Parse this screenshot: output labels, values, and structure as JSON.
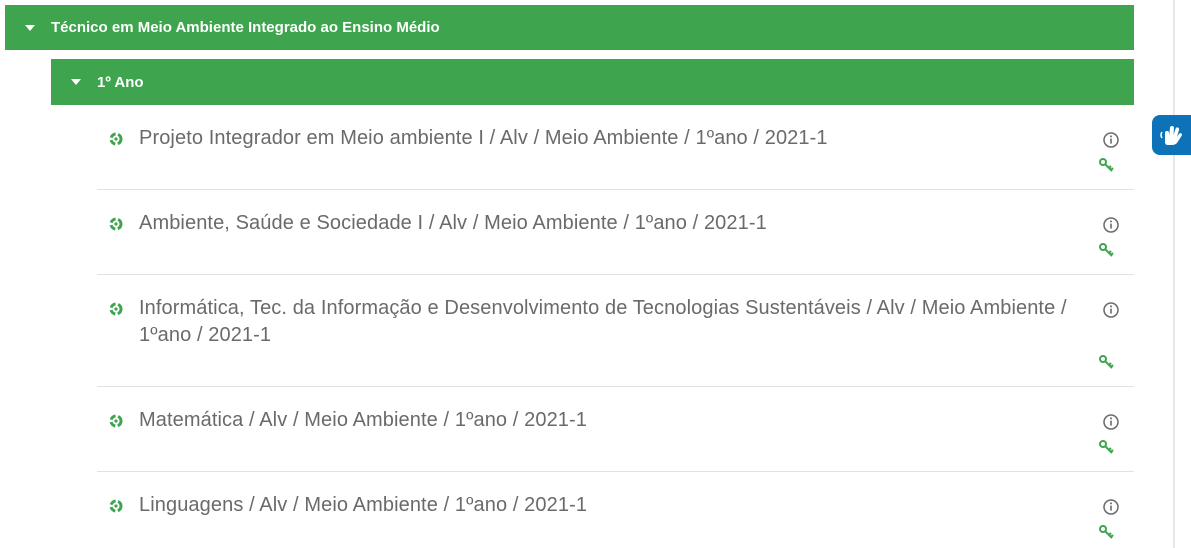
{
  "category": {
    "title": "Técnico em Meio Ambiente Integrado ao Ensino Médio",
    "subcategory": {
      "title": "1º Ano",
      "courses": [
        {
          "name": "Projeto Integrador em Meio ambiente I / Alv / Meio Ambiente / 1ºano / 2021-1"
        },
        {
          "name": "Ambiente, Saúde e Sociedade I / Alv / Meio Ambiente / 1ºano / 2021-1"
        },
        {
          "name": "Informática, Tec. da Informação e Desenvolvimento de Tecnologias Sustentáveis / Alv / Meio Ambiente / 1ºano / 2021-1"
        },
        {
          "name": "Matemática / Alv / Meio Ambiente / 1ºano / 2021-1"
        },
        {
          "name": "Linguagens / Alv / Meio Ambiente / 1ºano / 2021-1"
        }
      ]
    }
  },
  "colors": {
    "header_green": "#3ea54e",
    "course_text": "#6a6a6a",
    "key_green": "#3ea54e",
    "vlibras_blue": "#0d72b8"
  },
  "icons": {
    "expand": "caret-down-icon",
    "course": "course-bullet-icon",
    "info": "info-icon",
    "enrol": "key-icon",
    "accessibility": "vlibras-hand-icon"
  }
}
